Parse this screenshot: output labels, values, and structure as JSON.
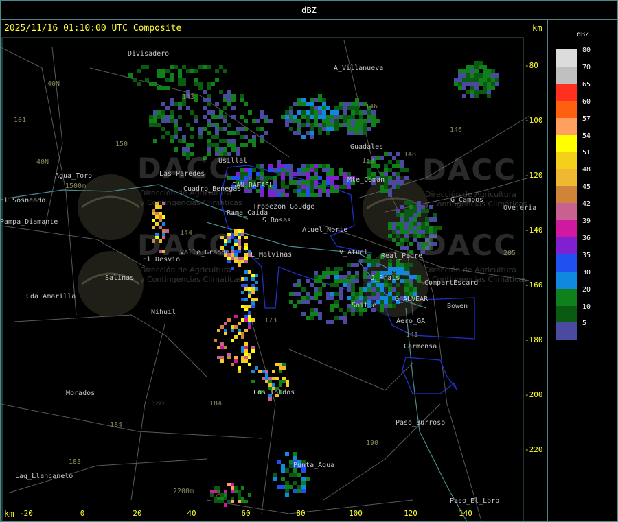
{
  "header": {
    "title": "dBZ"
  },
  "map": {
    "timestamp": "2025/11/16 01:10:00 UTC Composite",
    "unit_top": "km",
    "unit_bottom": "km",
    "y_ticks": [
      "-80",
      "-100",
      "-120",
      "-140",
      "-160",
      "-180",
      "-200",
      "-220"
    ],
    "x_ticks": [
      "-20",
      "0",
      "20",
      "40",
      "60",
      "80",
      "100",
      "120",
      "140"
    ],
    "watermarks": [
      {
        "text": "DACC",
        "sub1": "Dirección de Agricultura",
        "sub2": "y Contingencias Climáticas"
      },
      {
        "text": "DACC",
        "sub1": "Dirección de Agricultura",
        "sub2": "y Contingencias Climáticas"
      },
      {
        "text": "DACC",
        "sub1": "Dirección de Agricultura",
        "sub2": "y Contingencias Climáticas"
      },
      {
        "text": "DACC",
        "sub1": "Dirección de Agricultura",
        "sub2": "y Contingencias Climáticas"
      }
    ],
    "places": [
      "Divisadero",
      "A_Villanueva",
      "Usillal",
      "Cuadro_Benegas",
      "Las Paredes",
      "Rama_Caida",
      "SAN RAFAEL",
      "Atuel_Norte",
      "S_Rosas",
      "El_Desvio",
      "Valle_Grande",
      "L_Malvinas",
      "Salinas",
      "Cda_Amarilla",
      "Nihuil",
      "Morados",
      "Los_Toldos",
      "Punta_Agua",
      "Lag_Llancanelo",
      "Agua_Toro",
      "Pampa_Diamante",
      "Guadales",
      "Mte_Coman",
      "G_Campos",
      "V_Atuel",
      "Real_Padre",
      "J_Prats",
      "CompartEscard",
      "G_ALVEAR",
      "Bowen",
      "Soitue",
      "Aero_GA",
      "Carmensa",
      "Paso_Burroso",
      "Paso_El_Loro",
      "Ovejeria",
      "Tropezon",
      "Goudge",
      "El_Sosneado"
    ],
    "altitudes": [
      "1500m",
      "2200m"
    ],
    "route_numbers": [
      "40N",
      "40N",
      "101",
      "143",
      "150",
      "144",
      "173",
      "180",
      "184",
      "184",
      "183",
      "146",
      "148",
      "153",
      "190",
      "143",
      "205",
      "146"
    ]
  },
  "legend": {
    "title": "dBZ",
    "bins": [
      {
        "label": "80",
        "color": "#dcdcdc"
      },
      {
        "label": "70",
        "color": "#c0c0c0"
      },
      {
        "label": "65",
        "color": "#ff3020"
      },
      {
        "label": "60",
        "color": "#ff6010"
      },
      {
        "label": "57",
        "color": "#ff9f60"
      },
      {
        "label": "54",
        "color": "#ffff00"
      },
      {
        "label": "51",
        "color": "#f5d01a"
      },
      {
        "label": "48",
        "color": "#f0b830"
      },
      {
        "label": "45",
        "color": "#d0843a"
      },
      {
        "label": "42",
        "color": "#c86090"
      },
      {
        "label": "39",
        "color": "#d018a0"
      },
      {
        "label": "36",
        "color": "#8020d0"
      },
      {
        "label": "35",
        "color": "#2050f0"
      },
      {
        "label": "30",
        "color": "#1088e0"
      },
      {
        "label": "20",
        "color": "#10801a"
      },
      {
        "label": "10",
        "color": "#0a5a14"
      },
      {
        "label": "5",
        "color": "#4a4aa0"
      }
    ]
  }
}
